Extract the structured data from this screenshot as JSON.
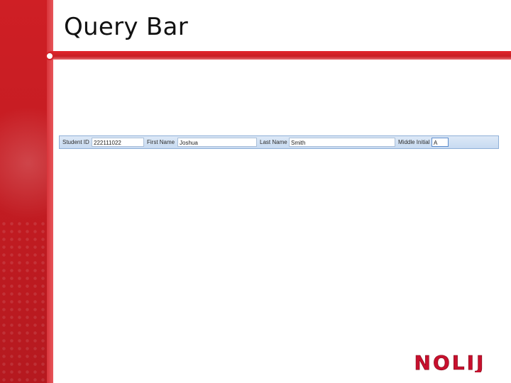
{
  "slide": {
    "title": "Query Bar"
  },
  "query_bar": {
    "fields": [
      {
        "label": "Student ID",
        "value": "222111022"
      },
      {
        "label": "First Name",
        "value": "Joshua"
      },
      {
        "label": "Last Name",
        "value": "Smith"
      },
      {
        "label": "Middle Initial",
        "value": "A"
      }
    ]
  },
  "logo": {
    "text": "NOLIJ",
    "color": "#c8102e"
  },
  "colors": {
    "accent": "#d32228",
    "query_bar_bg": "#c7daf1"
  }
}
